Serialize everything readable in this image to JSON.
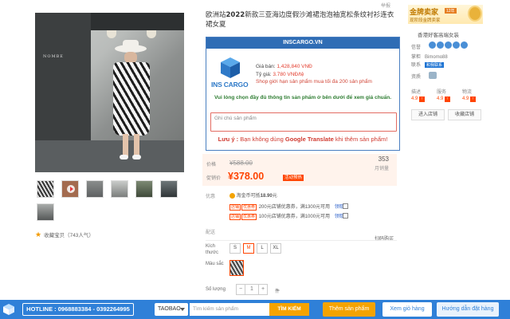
{
  "product": {
    "title_pre": "欧洲站",
    "title_year": "2022",
    "title_rest": "新款三亚海边度假沙滩裙泡泡袖宽松条纹衬衫连衣裙女夏",
    "report": "举报",
    "photo_shop_sign": "NOMBE",
    "favorite": "收藏宝贝（743人气）"
  },
  "extension": {
    "header": "INSCARGO.VN",
    "logo_text": "INS CARGO",
    "price_label": "Giá bán:",
    "price_value": "1,428,840 VNĐ",
    "rate_label": "Tỷ giá:",
    "rate_value": "3.780 VNĐ/tệ",
    "limit_note": "Shop giới hạn sản phẩm mua tối đa 200 sản phẩm",
    "choose_note": "Vui lòng chọn đầy đủ thông tin sản phẩm ở bên dưới để xem giá chuẩn.",
    "note_placeholder": "Ghi chú sản phẩm",
    "warn_prefix": "Lưu ý :",
    "warn_mid": "Bạn không dùng",
    "warn_bold": "Google Translate",
    "warn_suffix": "khi thêm sản phẩm!"
  },
  "price": {
    "label_original": "价格",
    "original": "¥588.00",
    "label_now": "促销价",
    "now": "¥378.00",
    "tag": "活动预热",
    "sold_count": "353",
    "sold_label": "月销量"
  },
  "promo": {
    "label": "优惠",
    "coin_text": "淘金币可抵",
    "coin_value": "18.90",
    "coin_unit": "元",
    "tag_shop": "店铺",
    "tag_coupon": "优惠券",
    "coupon1": "200元店铺优惠券，满1300元可用",
    "coupon2": "100元店铺优惠券，满1000元可用",
    "get1": "领取",
    "get2": "领取"
  },
  "delivery": {
    "label": "配送",
    "scan": "扫码购买"
  },
  "options": {
    "size_label": "Kích thước",
    "sizes": [
      "S",
      "M",
      "L",
      "XL"
    ],
    "selected_size": "M",
    "color_label": "Màu sắc",
    "qty_label": "Số lượng",
    "qty_value": "1",
    "qty_minus": "−",
    "qty_plus": "+",
    "qty_unit": "件"
  },
  "seller": {
    "badge": "金牌卖家",
    "years": "12年",
    "subtitle": "现阶段金牌卖家",
    "shop_name": "香港好客高端女装",
    "credit_label": "信誉",
    "owner_label": "掌柜",
    "owner": "Bimomo88",
    "contact_label": "联系",
    "contact_badge": "和我联系",
    "bond_label": "资质",
    "scores": [
      {
        "label": "描述",
        "value": "4.9"
      },
      {
        "label": "服务",
        "value": "4.9"
      },
      {
        "label": "物流",
        "value": "4.9"
      }
    ],
    "enter_shop": "进入店铺",
    "fav_shop": "收藏店铺"
  },
  "toolbar": {
    "hotline": "HOTLINE : 0968883384 - 0392264995",
    "source": "TAOBAO",
    "search_placeholder": "Tìm kiếm sản phẩm",
    "search_btn": "TÌM KIẾM",
    "add_btn": "Thêm sản phẩm",
    "cart_btn": "Xem giỏ hàng",
    "guide_btn": "Hướng dẫn đặt hàng"
  },
  "colors": {
    "accent": "#ff4400",
    "extension_blue": "#2f6db5",
    "toolbar_blue": "#2f80d8",
    "cta_orange": "#f5a300"
  }
}
